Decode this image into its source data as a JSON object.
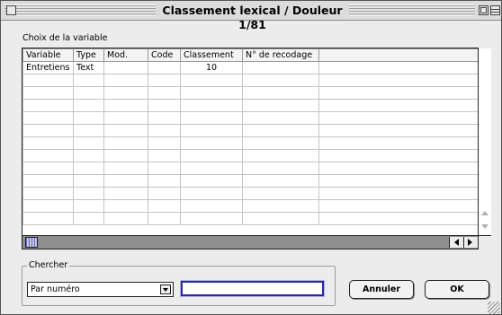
{
  "window": {
    "title": "Classement lexical / Douleur 1/81"
  },
  "variable_section": {
    "label": "Choix de la variable",
    "columns": [
      "Variable",
      "Type",
      "Mod.",
      "Code",
      "Classement",
      "N° de recodage",
      ""
    ],
    "rows": [
      [
        "Entretiens",
        "Text",
        "",
        "",
        "10",
        "",
        ""
      ]
    ]
  },
  "search_section": {
    "label": "Chercher",
    "select_value": "Par numéro",
    "input_value": ""
  },
  "buttons": {
    "cancel": "Annuler",
    "ok": "OK"
  }
}
